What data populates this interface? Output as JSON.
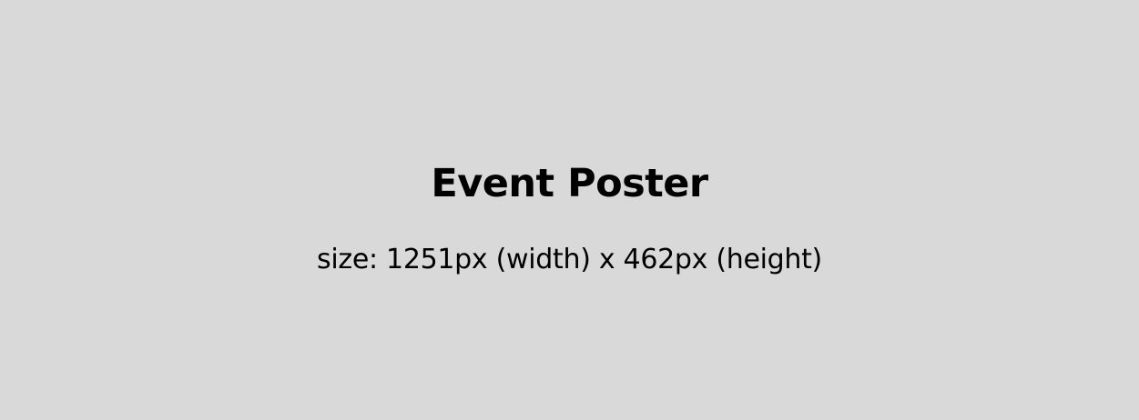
{
  "poster": {
    "title": "Event Poster",
    "size_label": "size: 1251px (width) x 462px (height)"
  },
  "colors": {
    "background": "#d9d9d9",
    "text": "#000000"
  }
}
